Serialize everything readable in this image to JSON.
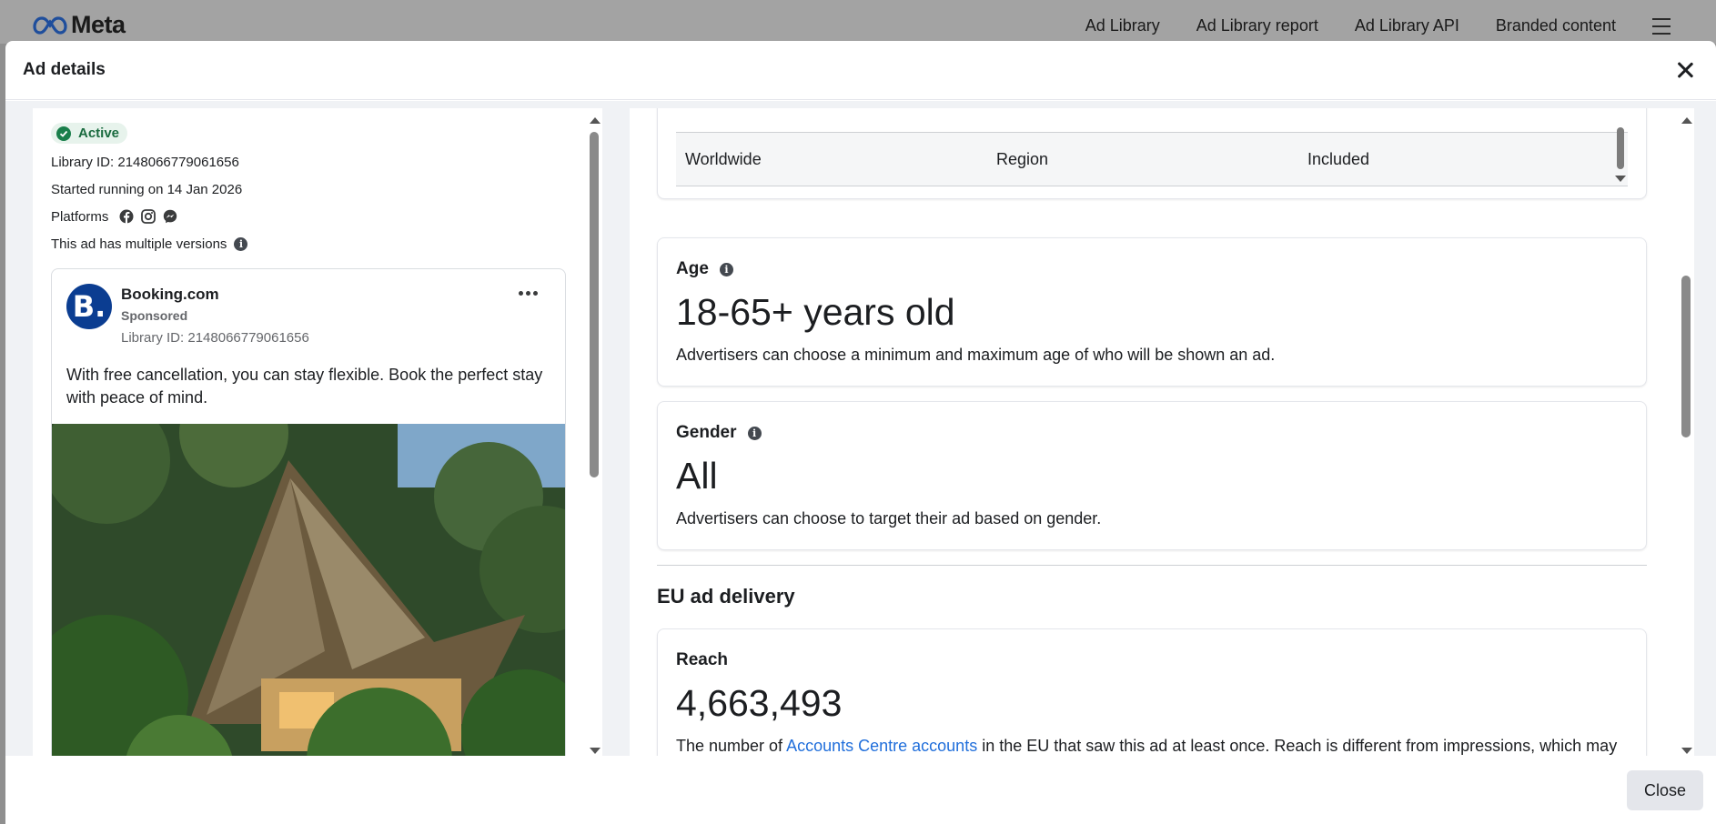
{
  "topbar": {
    "logo_text": "Meta",
    "nav": [
      "Ad Library",
      "Ad Library report",
      "Ad Library API",
      "Branded content"
    ]
  },
  "modal": {
    "title": "Ad details",
    "footer_close": "Close"
  },
  "ad_meta": {
    "status": "Active",
    "library_id": "Library ID: 2148066779061656",
    "started": "Started running on 14 Jan 2026",
    "platforms_label": "Platforms",
    "platforms": [
      "facebook-icon",
      "instagram-icon",
      "messenger-icon"
    ],
    "versions_note": "This ad has multiple versions"
  },
  "ad_card": {
    "advertiser": "Booking.com",
    "avatar_text": "B.",
    "sponsored": "Sponsored",
    "library_id": "Library ID: 2148066779061656",
    "body": "With free cancellation, you can stay flexible. Book the perfect stay with peace of mind."
  },
  "location_row": {
    "location": "Worldwide",
    "type": "Region",
    "status": "Included"
  },
  "age": {
    "label": "Age",
    "value": "18-65+ years old",
    "desc": "Advertisers can choose a minimum and maximum age of who will be shown an ad."
  },
  "gender": {
    "label": "Gender",
    "value": "All",
    "desc": "Advertisers can choose to target their ad based on gender."
  },
  "eu": {
    "section_title": "EU ad delivery",
    "reach_label": "Reach",
    "reach_value": "4,663,493",
    "reach_desc_pre": "The number of ",
    "reach_desc_link": "Accounts Centre accounts",
    "reach_desc_post": " in the EU that saw this ad at least once. Reach is different from impressions, which may"
  },
  "colors": {
    "accent_link": "#216fdb",
    "active_green": "#1a7f4b",
    "brand_booking": "#0b3d91"
  }
}
